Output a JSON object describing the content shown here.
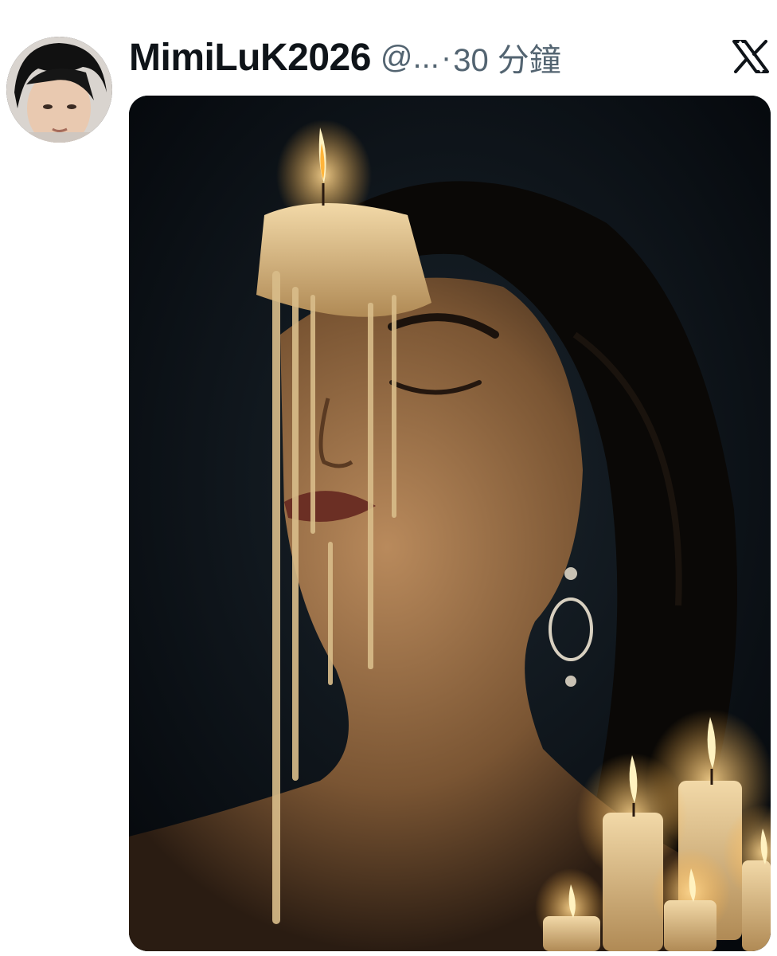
{
  "tweet": {
    "author_name": "MimiLuK2026",
    "author_handle": "@...",
    "separator": "·",
    "timestamp": "30 分鐘",
    "avatar_icon": "user-avatar",
    "platform_icon": "x-logo-icon",
    "media": {
      "type": "photo"
    }
  },
  "colors": {
    "text_primary": "#0f1419",
    "text_secondary": "#536471",
    "background": "#ffffff"
  }
}
